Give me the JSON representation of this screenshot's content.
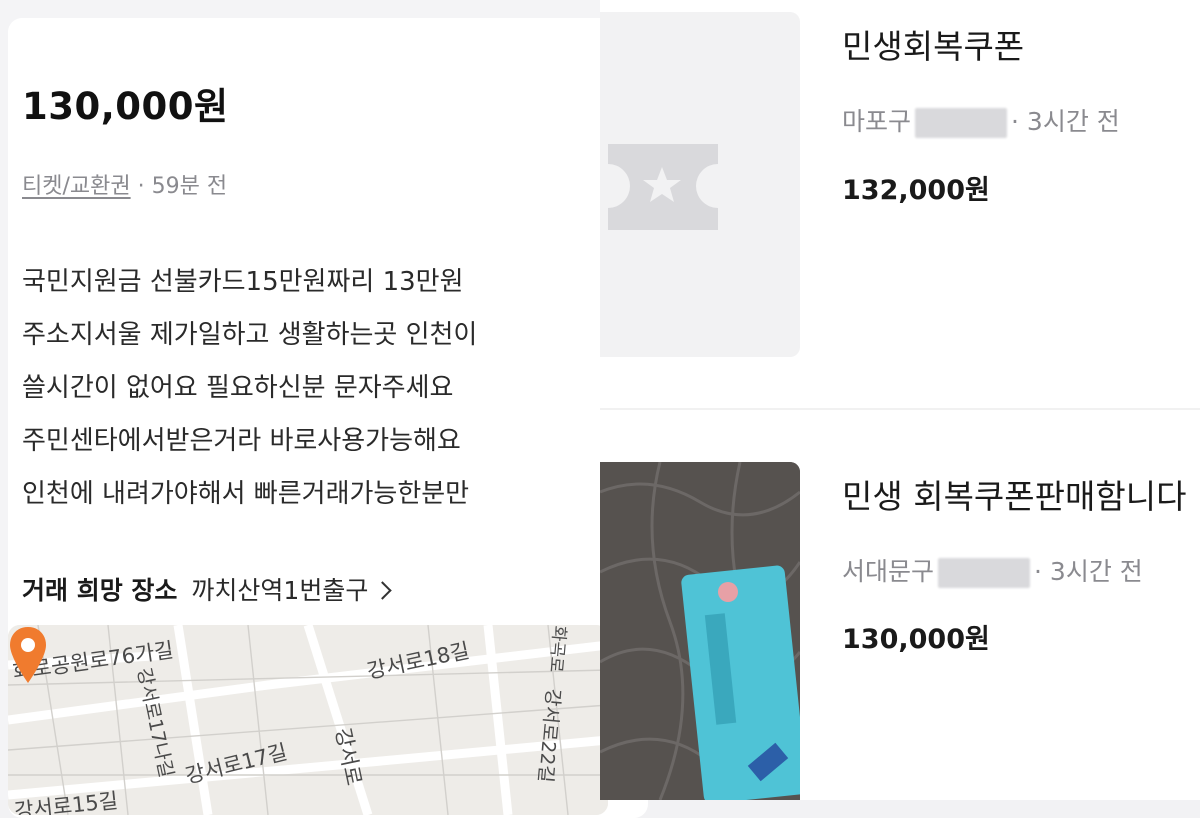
{
  "detail": {
    "price": "130,000원",
    "category": "티켓/교환권",
    "separator": " · ",
    "time": "59분 전",
    "description_lines": [
      "국민지원금 선불카드15만원짜리 13만원",
      "주소지서울 제가일하고 생활하는곳 인천이",
      "쓸시간이 없어요 필요하신분 문자주세요",
      "주민센타에서받은거라  바로사용가능해요",
      "인천에 내려가야해서 빠른거래가능한분만"
    ],
    "trade_label": "거래 희망 장소",
    "trade_place": "까치산역1번출구",
    "map_labels": {
      "l1": "화로공원로76가길",
      "l2": "강서로17나길",
      "l3": "강서로18길",
      "l4": "강서로17길",
      "l5": "강서로",
      "l6": "강서로15길",
      "l7": "강서로22길",
      "l8": "화곡로"
    }
  },
  "listings": [
    {
      "title": "민생회복쿠폰",
      "location": "마포구",
      "time": "· 3시간 전",
      "price": "132,000원",
      "thumbnail_icon": "ticket-star-icon"
    },
    {
      "title": "민생 회복쿠폰판매함니다",
      "location": "서대문구",
      "time": "· 3시간 전",
      "price": "130,000원",
      "thumbnail_icon": "photo-card-on-jacket"
    }
  ],
  "colors": {
    "pin": "#f07b2e",
    "card_teal": "#4fc3d6",
    "muted": "#8a8a8f"
  }
}
